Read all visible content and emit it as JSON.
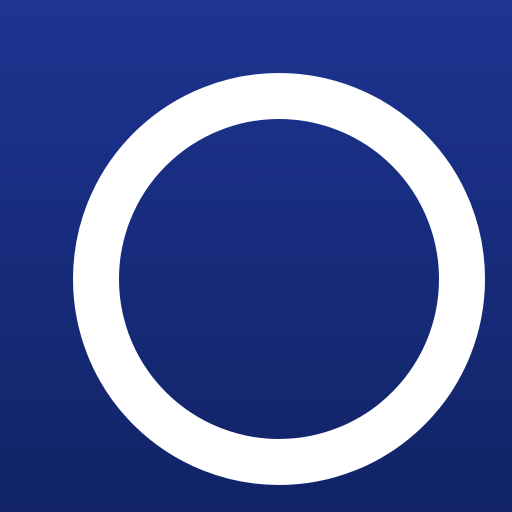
{
  "icon": {
    "name": "ring-icon",
    "background_color_top": "#1d3491",
    "background_color_bottom": "#112366",
    "ring_color": "#ffffff"
  }
}
